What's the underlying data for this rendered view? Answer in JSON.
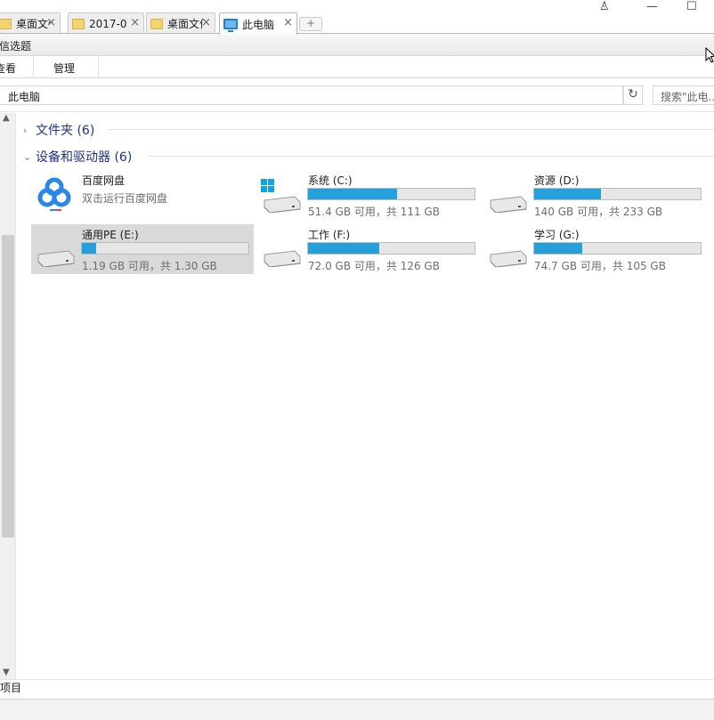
{
  "tabs": [
    {
      "label": "桌面文件",
      "icon": "folder-icon"
    },
    {
      "label": "2017-0",
      "icon": "folder-icon"
    },
    {
      "label": "桌面文件",
      "icon": "folder-icon"
    },
    {
      "label": "此电脑",
      "icon": "this-pc-icon"
    }
  ],
  "tab_close": "×",
  "new_tab": "+",
  "window": {
    "user_glyph": "♙",
    "minimize_glyph": "—",
    "maximize_glyph": "☐"
  },
  "ribbon": {
    "title": "信选题",
    "tabs": [
      "查看",
      "管理"
    ]
  },
  "address": {
    "path": "此电脑",
    "dropdown_glyph": "⌄",
    "refresh_glyph": "↻",
    "search_placeholder": "搜索\"此电..."
  },
  "groups": {
    "folders": {
      "label": "文件夹 (6)",
      "chevron": "›"
    },
    "devices": {
      "label": "设备和驱动器 (6)",
      "chevron": "⌄"
    }
  },
  "devices": [
    {
      "name": "百度网盘",
      "subtitle": "双击运行百度网盘",
      "icon": "baidu-netdisk-icon"
    },
    {
      "name": "系统 (C:)",
      "free_text": "51.4 GB 可用，共 111 GB",
      "used_fraction": 0.537,
      "icon": "windows-drive-icon"
    },
    {
      "name": "资源 (D:)",
      "free_text": "140 GB 可用，共 233 GB",
      "used_fraction": 0.4,
      "icon": "hard-drive-icon"
    },
    {
      "name": "通用PE (E:)",
      "free_text": "1.19 GB 可用，共 1.30 GB",
      "used_fraction": 0.085,
      "icon": "hard-drive-icon",
      "selected": true
    },
    {
      "name": "工作 (F:)",
      "free_text": "72.0 GB 可用，共 126 GB",
      "used_fraction": 0.429,
      "icon": "hard-drive-icon"
    },
    {
      "name": "学习 (G:)",
      "free_text": "74.7 GB 可用，共 105 GB",
      "used_fraction": 0.289,
      "icon": "hard-drive-icon"
    }
  ],
  "status": {
    "items_label": "项目"
  },
  "colors": {
    "accent": "#26a0da",
    "group_header": "#1e3287",
    "selected_tile": "#d9d9d9"
  }
}
